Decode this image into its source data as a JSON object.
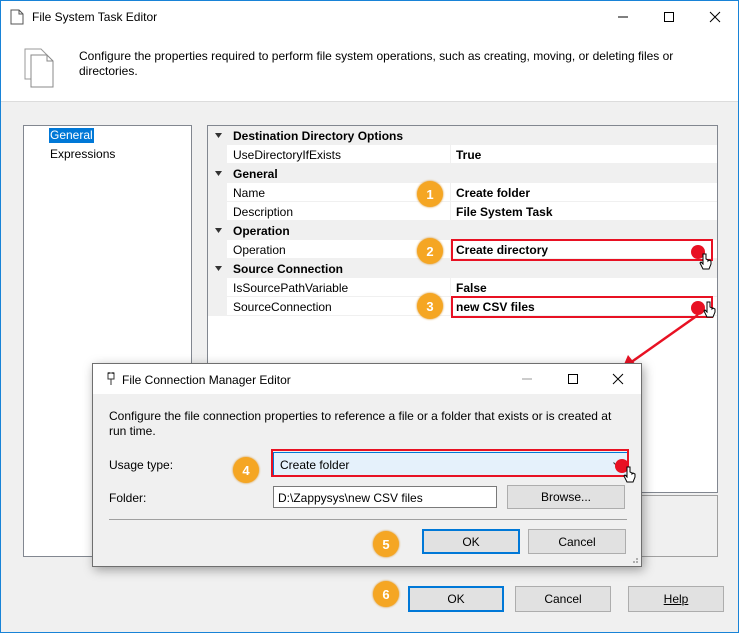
{
  "window": {
    "title": "File System Task Editor",
    "description": "Configure the properties required to perform file system operations, such as creating, moving, or deleting files or directories."
  },
  "nav": {
    "items": [
      {
        "label": "General",
        "selected": true
      },
      {
        "label": "Expressions",
        "selected": false
      }
    ]
  },
  "properties": {
    "cat_destination": "Destination Directory Options",
    "use_dir_name": "UseDirectoryIfExists",
    "use_dir_value": "True",
    "cat_general": "General",
    "name_name": "Name",
    "name_value": "Create folder",
    "desc_name": "Description",
    "desc_value": "File System Task",
    "cat_operation": "Operation",
    "operation_name": "Operation",
    "operation_value": "Create directory",
    "cat_source": "Source Connection",
    "is_source_var_name": "IsSourcePathVariable",
    "is_source_var_value": "False",
    "source_conn_name": "SourceConnection",
    "source_conn_value": "new CSV files"
  },
  "buttons": {
    "ok": "OK",
    "cancel": "Cancel",
    "help": "Help"
  },
  "dialog": {
    "title": "File Connection Manager Editor",
    "description": "Configure the file connection properties to reference a file or a folder that exists or is created at run time.",
    "usage_label": "Usage type:",
    "usage_value": "Create folder",
    "folder_label": "Folder:",
    "folder_value": "D:\\Zappysys\\new CSV files",
    "browse": "Browse...",
    "ok": "OK",
    "cancel": "Cancel"
  },
  "badges": [
    "1",
    "2",
    "3",
    "4",
    "5",
    "6"
  ],
  "colors": {
    "accent": "#0078d7",
    "highlight": "#e81123",
    "badge": "#f5a623"
  }
}
